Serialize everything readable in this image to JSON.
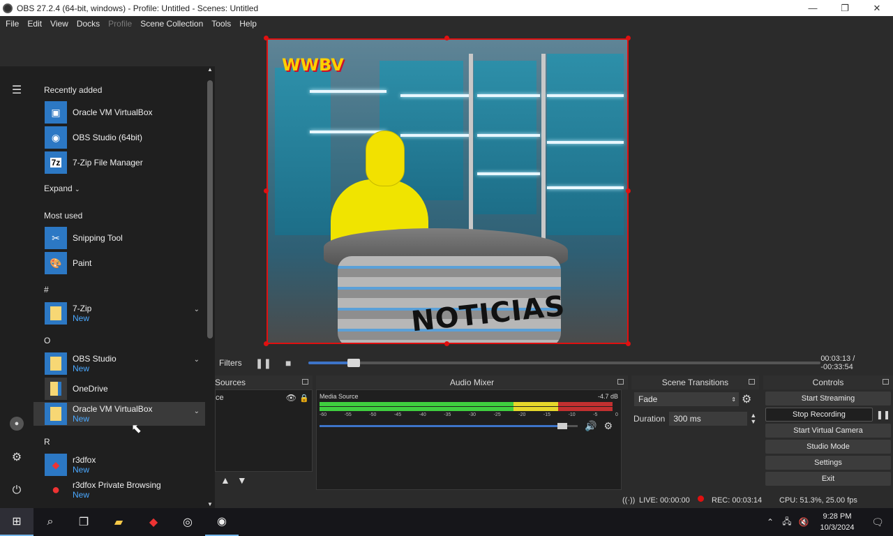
{
  "window": {
    "title": "OBS 27.2.4 (64-bit, windows) - Profile: Untitled - Scenes: Untitled",
    "minimize_glyph": "—",
    "maximize_glyph": "❐",
    "close_glyph": "✕"
  },
  "menubar": [
    "File",
    "Edit",
    "View",
    "Docks",
    "Profile",
    "Scene Collection",
    "Tools",
    "Help"
  ],
  "preview": {
    "logo_text": "WWBV",
    "desk_text": "NOTICIAS"
  },
  "transport": {
    "filters_label": "Filters",
    "current_time": "00:03:13",
    "remaining_time": "-00:33:54",
    "progress": 0.087
  },
  "sources": {
    "title": "Sources",
    "item_label": "ce"
  },
  "audio_mixer": {
    "title": "Audio Mixer",
    "channel_name": "Media Source",
    "level_db": "-4.7 dB",
    "ticks": [
      "-60",
      "-55",
      "-50",
      "-45",
      "-40",
      "-35",
      "-30",
      "-25",
      "-20",
      "-15",
      "-10",
      "-5",
      "0"
    ],
    "volume": 0.96
  },
  "scene_transitions": {
    "title": "Scene Transitions",
    "transition": "Fade",
    "duration_label": "Duration",
    "duration_value": "300 ms"
  },
  "controls": {
    "title": "Controls",
    "start_streaming": "Start Streaming",
    "stop_recording": "Stop Recording",
    "start_virtual_camera": "Start Virtual Camera",
    "studio_mode": "Studio Mode",
    "settings": "Settings",
    "exit": "Exit"
  },
  "statusbar": {
    "live": "LIVE: 00:00:00",
    "rec": "REC: 00:03:14",
    "cpu": "CPU: 51.3%, 25.00 fps",
    "rec_color": "#e01010"
  },
  "start_menu": {
    "recently_added_label": "Recently added",
    "expand_label": "Expand",
    "most_used_label": "Most used",
    "new_label": "New",
    "recent": [
      {
        "name": "Oracle VM VirtualBox"
      },
      {
        "name": "OBS Studio (64bit)"
      },
      {
        "name": "7-Zip File Manager"
      }
    ],
    "most_used": [
      {
        "name": "Snipping Tool"
      },
      {
        "name": "Paint"
      }
    ],
    "groups": [
      {
        "letter": "#",
        "apps": [
          {
            "name": "7-Zip"
          }
        ]
      },
      {
        "letter": "O",
        "apps": [
          {
            "name": "OBS Studio"
          },
          {
            "name": "OneDrive"
          },
          {
            "name": "Oracle VM VirtualBox"
          }
        ]
      },
      {
        "letter": "R",
        "apps": [
          {
            "name": "r3dfox"
          },
          {
            "name": "r3dfox Private Browsing"
          }
        ]
      }
    ]
  },
  "taskbar": {
    "time": "9:28 PM",
    "date": "10/3/2024",
    "accent": "#76b9ed"
  }
}
